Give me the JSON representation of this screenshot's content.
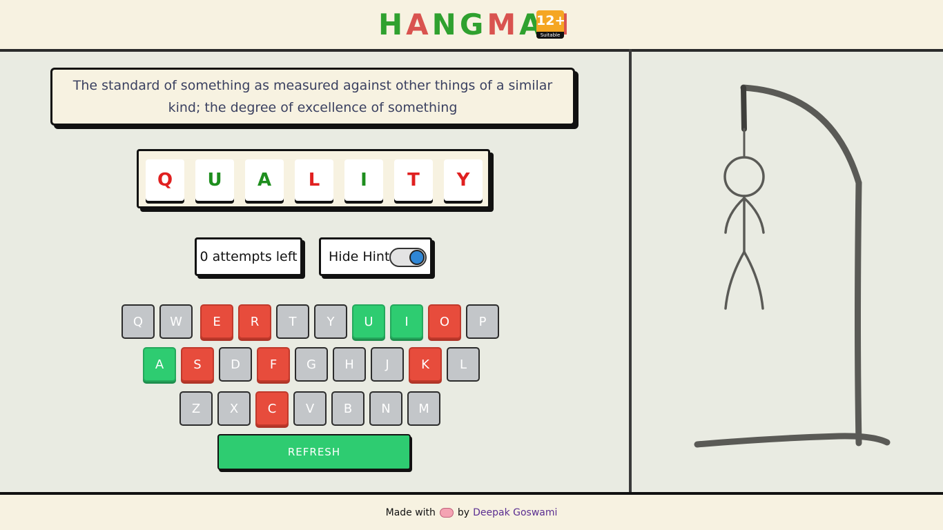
{
  "header": {
    "title_letters": [
      {
        "ch": "H",
        "color": "#2fa12f"
      },
      {
        "ch": "A",
        "color": "#d9534f"
      },
      {
        "ch": "N",
        "color": "#2fa12f"
      },
      {
        "ch": "G",
        "color": "#2fa12f"
      },
      {
        "ch": "M",
        "color": "#d9534f"
      },
      {
        "ch": "A",
        "color": "#2fa12f"
      },
      {
        "ch": "N",
        "color": "#d9534f"
      }
    ],
    "age_badge": "12+",
    "age_badge_sub": "Suitable for"
  },
  "hint": {
    "text": "The standard of something as measured against other things of a similar kind; the degree of excellence of something"
  },
  "word": {
    "letters": [
      {
        "ch": "Q",
        "color": "#e02020"
      },
      {
        "ch": "U",
        "color": "#1e8e1e"
      },
      {
        "ch": "A",
        "color": "#1e8e1e"
      },
      {
        "ch": "L",
        "color": "#e02020"
      },
      {
        "ch": "I",
        "color": "#1e8e1e"
      },
      {
        "ch": "T",
        "color": "#e02020"
      },
      {
        "ch": "Y",
        "color": "#e02020"
      }
    ]
  },
  "status": {
    "attempts_text": "0 attempts left",
    "hint_toggle_label": "Hide Hint",
    "hint_toggle_on": true
  },
  "keyboard": {
    "rows": [
      [
        {
          "key": "Q",
          "state": "unused"
        },
        {
          "key": "W",
          "state": "unused"
        },
        {
          "key": "E",
          "state": "wrong"
        },
        {
          "key": "R",
          "state": "wrong"
        },
        {
          "key": "T",
          "state": "unused"
        },
        {
          "key": "Y",
          "state": "unused"
        },
        {
          "key": "U",
          "state": "right"
        },
        {
          "key": "I",
          "state": "right"
        },
        {
          "key": "O",
          "state": "wrong"
        },
        {
          "key": "P",
          "state": "unused"
        }
      ],
      [
        {
          "key": "A",
          "state": "right"
        },
        {
          "key": "S",
          "state": "wrong"
        },
        {
          "key": "D",
          "state": "unused"
        },
        {
          "key": "F",
          "state": "wrong"
        },
        {
          "key": "G",
          "state": "unused"
        },
        {
          "key": "H",
          "state": "unused"
        },
        {
          "key": "J",
          "state": "unused"
        },
        {
          "key": "K",
          "state": "wrong"
        },
        {
          "key": "L",
          "state": "unused"
        }
      ],
      [
        {
          "key": "Z",
          "state": "unused"
        },
        {
          "key": "X",
          "state": "unused"
        },
        {
          "key": "C",
          "state": "wrong"
        },
        {
          "key": "V",
          "state": "unused"
        },
        {
          "key": "B",
          "state": "unused"
        },
        {
          "key": "N",
          "state": "unused"
        },
        {
          "key": "M",
          "state": "unused"
        }
      ]
    ],
    "refresh_label": "REFRESH"
  },
  "footer": {
    "made_with": "Made with",
    "by": "by",
    "author": "Deepak Goswami"
  }
}
